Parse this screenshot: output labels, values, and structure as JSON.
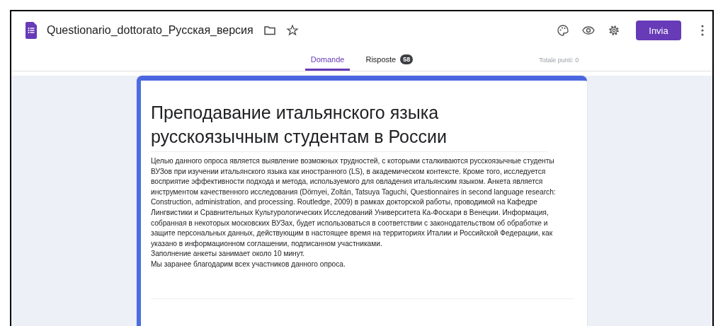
{
  "header": {
    "title": "Questionario_dottorato_Русская_версия",
    "send_button": "Invia"
  },
  "tabs": [
    {
      "label": "Domande",
      "selected": true
    },
    {
      "label": "Risposte",
      "selected": false,
      "badge": "58"
    }
  ],
  "total_points": "Totale punti: 0",
  "form": {
    "title": "Преподавание итальянского языка русскоязычным студентам в России",
    "description": [
      "Целью данного опроса является выявление возможных трудностей, с которыми сталкиваются русскоязычные студенты ВУЗов при изучении итальянского языка как иностранного (LS), в академическом контексте. Кроме того, исследуется восприятие эффективности подхода и метода, используемого для овладения итальянским языком. Анкета является инструментом качественного исследования (Dörnyei, Zoltán, Tatsuya Taguchi, Questionnaires in second language research: Construction, administration, and processing. Routledge, 2009) в рамках докторской работы, проводимой на Кафедре Лингвистики и Сравнительных Культурологических Исследований Университета Ка-Фоскари в Венеции. Информация, собранная в некоторых московских ВУЗах, будет использоваться в соответствии с законодательством об обработке и защите персональных данных, действующим в настоящее время на территориях Италии и Российской Федерации, как указано в информационном соглашении, подписанном участниками.",
      "Заполнение анкеты занимает около 10 минут.",
      "Мы заранее благодарим всех участников данного опроса."
    ]
  }
}
